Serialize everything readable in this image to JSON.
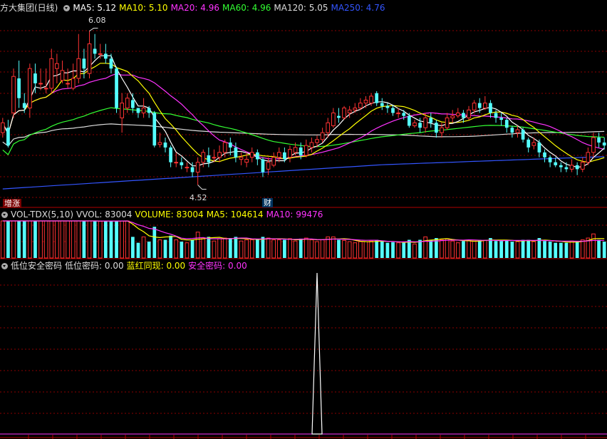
{
  "header": {
    "title": "方大集团(日线)",
    "ma": [
      {
        "label": "MA5: 5.12",
        "color": "#ffffff"
      },
      {
        "label": "MA10: 5.10",
        "color": "#ffff00"
      },
      {
        "label": "MA20: 4.96",
        "color": "#ff33ff"
      },
      {
        "label": "MA60: 4.96",
        "color": "#33ff33"
      },
      {
        "label": "MA120: 5.05",
        "color": "#dddddd"
      },
      {
        "label": "MA250: 4.76",
        "color": "#3355ff"
      }
    ]
  },
  "annotations": {
    "high": "6.08",
    "low": "4.52",
    "tag_left": "增涨",
    "tag_cai": "财"
  },
  "vol_header": {
    "name": "VOL-TDX(5,10)",
    "vvol": "VVOL: 83004",
    "volume": "VOLUME: 83004",
    "ma5": "MA5: 104614",
    "ma10": "MA10: 99476"
  },
  "ind_header": {
    "name": "低位安全密码",
    "p1": "低位密码: 0.00",
    "p2": "蓝红同现: 0.00",
    "p3": "安全密码: 0.00"
  },
  "colors": {
    "up": "#ff3333",
    "down": "#55ffff",
    "grid": "#8b0000",
    "panel_border": "#b00000"
  },
  "chart_data": [
    {
      "type": "candlestick",
      "title": "方大集团(日线)",
      "ylim": [
        4.3,
        6.25
      ],
      "high_marker": 6.08,
      "low_marker": 4.52,
      "ohlc": [
        [
          5.05,
          5.15,
          5.2,
          5.0
        ],
        [
          5.1,
          4.92,
          5.18,
          4.9
        ],
        [
          5.25,
          5.62,
          5.7,
          5.2
        ],
        [
          5.6,
          5.4,
          5.78,
          5.3
        ],
        [
          5.35,
          5.3,
          5.45,
          5.25
        ],
        [
          5.3,
          5.7,
          5.75,
          5.2
        ],
        [
          5.65,
          5.55,
          5.75,
          5.45
        ],
        [
          5.55,
          5.55,
          5.7,
          5.48
        ],
        [
          5.5,
          5.5,
          5.7,
          5.45
        ],
        [
          5.5,
          5.8,
          5.9,
          5.45
        ],
        [
          5.7,
          5.75,
          5.85,
          5.55
        ],
        [
          5.58,
          5.68,
          5.78,
          5.55
        ],
        [
          5.55,
          5.55,
          5.7,
          5.5
        ],
        [
          5.5,
          5.6,
          5.75,
          5.48
        ],
        [
          5.6,
          5.8,
          6.05,
          5.55
        ],
        [
          5.8,
          5.7,
          5.9,
          5.6
        ],
        [
          5.65,
          5.95,
          6.08,
          5.6
        ],
        [
          5.9,
          5.85,
          6.05,
          5.8
        ],
        [
          5.85,
          5.85,
          5.95,
          5.8
        ],
        [
          5.85,
          5.8,
          5.95,
          5.75
        ],
        [
          5.8,
          5.7,
          5.85,
          5.65
        ],
        [
          5.7,
          5.3,
          5.72,
          5.25
        ],
        [
          5.2,
          5.35,
          5.45,
          5.05
        ],
        [
          5.3,
          5.4,
          5.45,
          5.25
        ],
        [
          5.38,
          5.3,
          5.45,
          5.25
        ],
        [
          5.3,
          5.25,
          5.3,
          5.2
        ],
        [
          5.25,
          5.3,
          5.4,
          5.2
        ],
        [
          5.3,
          5.25,
          5.32,
          5.2
        ],
        [
          5.25,
          4.92,
          5.27,
          4.9
        ],
        [
          4.93,
          4.95,
          5.05,
          4.9
        ],
        [
          4.95,
          4.9,
          5.0,
          4.85
        ],
        [
          4.9,
          4.75,
          4.92,
          4.7
        ],
        [
          4.75,
          4.75,
          4.85,
          4.7
        ],
        [
          4.75,
          4.72,
          4.8,
          4.68
        ],
        [
          4.7,
          4.7,
          4.75,
          4.65
        ],
        [
          4.7,
          4.65,
          4.75,
          4.6
        ],
        [
          4.65,
          4.75,
          4.8,
          4.52
        ],
        [
          4.75,
          4.85,
          4.88,
          4.7
        ],
        [
          4.82,
          4.75,
          4.9,
          4.7
        ],
        [
          4.8,
          4.8,
          4.88,
          4.75
        ],
        [
          4.8,
          4.85,
          4.92,
          4.75
        ],
        [
          4.85,
          4.95,
          4.98,
          4.8
        ],
        [
          4.95,
          4.9,
          5.0,
          4.82
        ],
        [
          4.9,
          4.8,
          4.95,
          4.75
        ],
        [
          4.78,
          4.8,
          4.85,
          4.72
        ],
        [
          4.75,
          4.78,
          4.85,
          4.7
        ],
        [
          4.8,
          4.85,
          4.9,
          4.75
        ],
        [
          4.85,
          4.78,
          4.88,
          4.72
        ],
        [
          4.78,
          4.65,
          4.8,
          4.6
        ],
        [
          4.68,
          4.75,
          4.8,
          4.62
        ],
        [
          4.72,
          4.8,
          4.85,
          4.7
        ],
        [
          4.8,
          4.85,
          4.9,
          4.75
        ],
        [
          4.85,
          4.78,
          4.9,
          4.75
        ],
        [
          4.8,
          4.88,
          4.92,
          4.75
        ],
        [
          4.85,
          4.9,
          4.95,
          4.82
        ],
        [
          4.9,
          4.82,
          4.95,
          4.78
        ],
        [
          4.82,
          4.92,
          4.98,
          4.8
        ],
        [
          4.9,
          4.95,
          5.0,
          4.85
        ],
        [
          4.95,
          4.98,
          5.02,
          4.9
        ],
        [
          4.98,
          5.05,
          5.1,
          4.95
        ],
        [
          5.05,
          5.15,
          5.2,
          5.0
        ],
        [
          5.12,
          5.25,
          5.3,
          5.1
        ],
        [
          5.22,
          5.2,
          5.3,
          5.15
        ],
        [
          5.2,
          5.3,
          5.32,
          5.18
        ],
        [
          5.25,
          5.28,
          5.32,
          5.2
        ],
        [
          5.28,
          5.3,
          5.35,
          5.25
        ],
        [
          5.3,
          5.35,
          5.4,
          5.28
        ],
        [
          5.35,
          5.38,
          5.42,
          5.3
        ],
        [
          5.35,
          5.42,
          5.45,
          5.32
        ],
        [
          5.45,
          5.35,
          5.47,
          5.32
        ],
        [
          5.35,
          5.32,
          5.4,
          5.28
        ],
        [
          5.32,
          5.3,
          5.35,
          5.25
        ],
        [
          5.3,
          5.25,
          5.33,
          5.22
        ],
        [
          5.25,
          5.25,
          5.3,
          5.2
        ],
        [
          5.25,
          5.22,
          5.28,
          5.18
        ],
        [
          5.22,
          5.12,
          5.25,
          5.1
        ],
        [
          5.12,
          5.15,
          5.18,
          5.1
        ],
        [
          5.15,
          5.1,
          5.2,
          5.05
        ],
        [
          5.1,
          5.2,
          5.25,
          5.05
        ],
        [
          5.2,
          5.15,
          5.25,
          5.1
        ],
        [
          5.15,
          5.05,
          5.18,
          5.0
        ],
        [
          5.05,
          5.1,
          5.15,
          5.0
        ],
        [
          5.1,
          5.2,
          5.25,
          5.08
        ],
        [
          5.2,
          5.22,
          5.28,
          5.15
        ],
        [
          5.22,
          5.25,
          5.3,
          5.2
        ],
        [
          5.25,
          5.2,
          5.28,
          5.15
        ],
        [
          5.2,
          5.28,
          5.32,
          5.18
        ],
        [
          5.28,
          5.35,
          5.38,
          5.25
        ],
        [
          5.35,
          5.3,
          5.4,
          5.25
        ],
        [
          5.3,
          5.35,
          5.42,
          5.28
        ],
        [
          5.35,
          5.25,
          5.38,
          5.2
        ],
        [
          5.25,
          5.2,
          5.28,
          5.15
        ],
        [
          5.2,
          5.18,
          5.25,
          5.12
        ],
        [
          5.18,
          5.1,
          5.2,
          5.05
        ],
        [
          5.1,
          5.05,
          5.12,
          5.0
        ],
        [
          5.05,
          5.08,
          5.12,
          5.0
        ],
        [
          5.08,
          4.98,
          5.1,
          4.95
        ],
        [
          4.98,
          4.9,
          5.0,
          4.85
        ],
        [
          4.92,
          4.95,
          5.0,
          4.88
        ],
        [
          4.95,
          4.85,
          4.98,
          4.8
        ],
        [
          4.85,
          4.8,
          4.88,
          4.75
        ],
        [
          4.8,
          4.75,
          4.82,
          4.7
        ],
        [
          4.75,
          4.72,
          4.8,
          4.7
        ],
        [
          4.72,
          4.7,
          4.75,
          4.65
        ],
        [
          4.7,
          4.68,
          4.75,
          4.65
        ],
        [
          4.68,
          4.72,
          4.78,
          4.65
        ],
        [
          4.72,
          4.68,
          4.75,
          4.62
        ],
        [
          4.68,
          4.75,
          4.8,
          4.65
        ],
        [
          4.75,
          4.85,
          4.9,
          4.72
        ],
        [
          4.85,
          5.0,
          5.05,
          4.8
        ],
        [
          5.0,
          4.95,
          5.05,
          4.9
        ],
        [
          4.95,
          4.92,
          5.0,
          4.88
        ]
      ]
    },
    {
      "type": "bar",
      "title": "VOL-TDX(5,10)",
      "vvol": 83004,
      "ma5": 104614,
      "ma10": 99476
    },
    {
      "type": "line",
      "title": "低位安全密码",
      "series": [
        {
          "name": "安全密码",
          "spike_at_bar": 58,
          "max": 1.0
        }
      ]
    }
  ]
}
